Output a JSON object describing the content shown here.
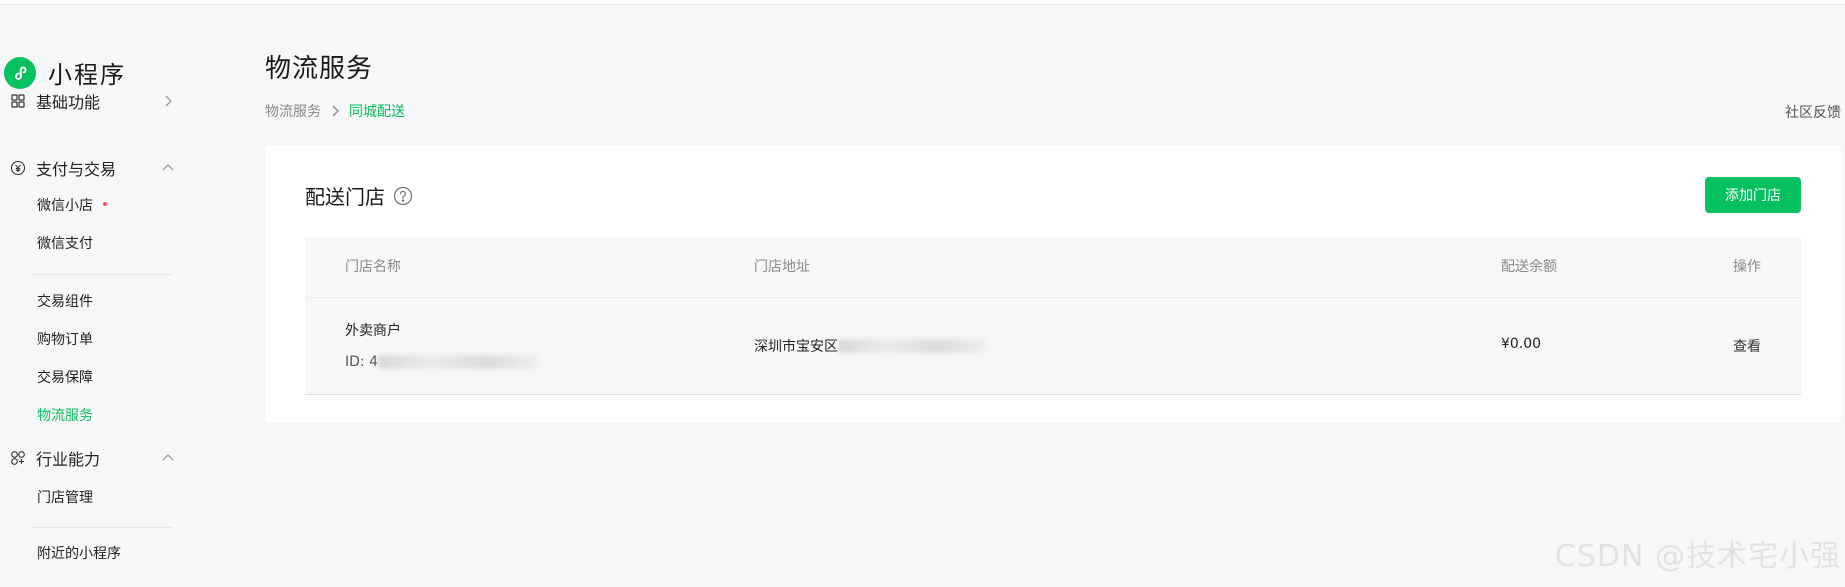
{
  "app": {
    "title": "小程序"
  },
  "sidebar": {
    "groups": [
      {
        "label": "基础功能",
        "icon": "grid-icon",
        "chevron": "right"
      },
      {
        "label": "支付与交易",
        "icon": "yen-circle-icon",
        "chevron": "up",
        "items": [
          {
            "label": "微信小店",
            "badge": "red-dot"
          },
          {
            "label": "微信支付"
          },
          {
            "label": "交易组件"
          },
          {
            "label": "购物订单"
          },
          {
            "label": "交易保障"
          },
          {
            "label": "物流服务",
            "active": true
          }
        ]
      },
      {
        "label": "行业能力",
        "icon": "industry-icon",
        "chevron": "up",
        "items": [
          {
            "label": "门店管理"
          },
          {
            "label": "附近的小程序"
          }
        ]
      }
    ]
  },
  "main": {
    "title": "物流服务",
    "breadcrumb": [
      "物流服务",
      "同城配送"
    ],
    "feedback_label": "社区反馈",
    "card": {
      "title": "配送门店",
      "add_button_label": "添加门店",
      "columns": [
        "门店名称",
        "门店地址",
        "配送余额",
        "操作"
      ],
      "rows": [
        {
          "name": "外卖商户",
          "id_label": "ID: 4",
          "address_prefix": "深圳市宝安区",
          "balance": "¥0.00",
          "action": "查看"
        }
      ]
    }
  },
  "watermark": "CSDN @技术宅小强",
  "colors": {
    "accent": "#07c160",
    "background": "#f6f7f9",
    "card": "#ffffff",
    "dot": "#fa5151"
  }
}
